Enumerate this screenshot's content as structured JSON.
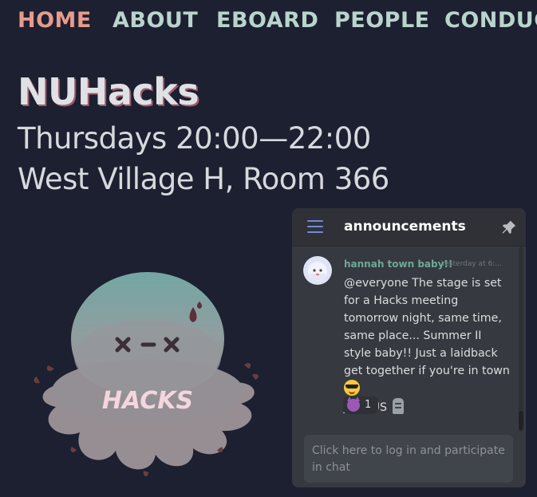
{
  "nav": {
    "items": [
      {
        "label": "HOME",
        "active": true
      },
      {
        "label": "ABOUT"
      },
      {
        "label": "EBOARD"
      },
      {
        "label": "PEOPLE"
      },
      {
        "label": "CONDUC"
      }
    ]
  },
  "hero": {
    "title": "NUHacks",
    "when": "Thursdays 20:00—22:00",
    "where": "West Village H, Room 366"
  },
  "mascot": {
    "label": "HACKS",
    "icon": "octopus-mascot"
  },
  "widget": {
    "channel": "announcements",
    "menu_icon": "hamburger-icon",
    "pin_icon": "pin-icon",
    "message": {
      "author": "hannah town baby!!",
      "timestamp": "Yesterday at 6:...",
      "text_main": "@everyone The stage is set for a Hacks meeting tomorrow night, same time, same place... Summer II style baby!! Just a laidback get together if you're in town ",
      "text_tail": "JOIN US ",
      "reaction": {
        "emoji": "smiling-imp",
        "count": "1"
      }
    },
    "login_prompt": "Click here to log in and participate in chat"
  },
  "colors": {
    "background": "#1c2030",
    "nav_active": "#e69b8c",
    "nav_inactive": "#b9d4cc",
    "widget_bg": "#36393f",
    "widget_header": "#2f3136",
    "author": "#6ea997",
    "accent": "#7289da"
  }
}
